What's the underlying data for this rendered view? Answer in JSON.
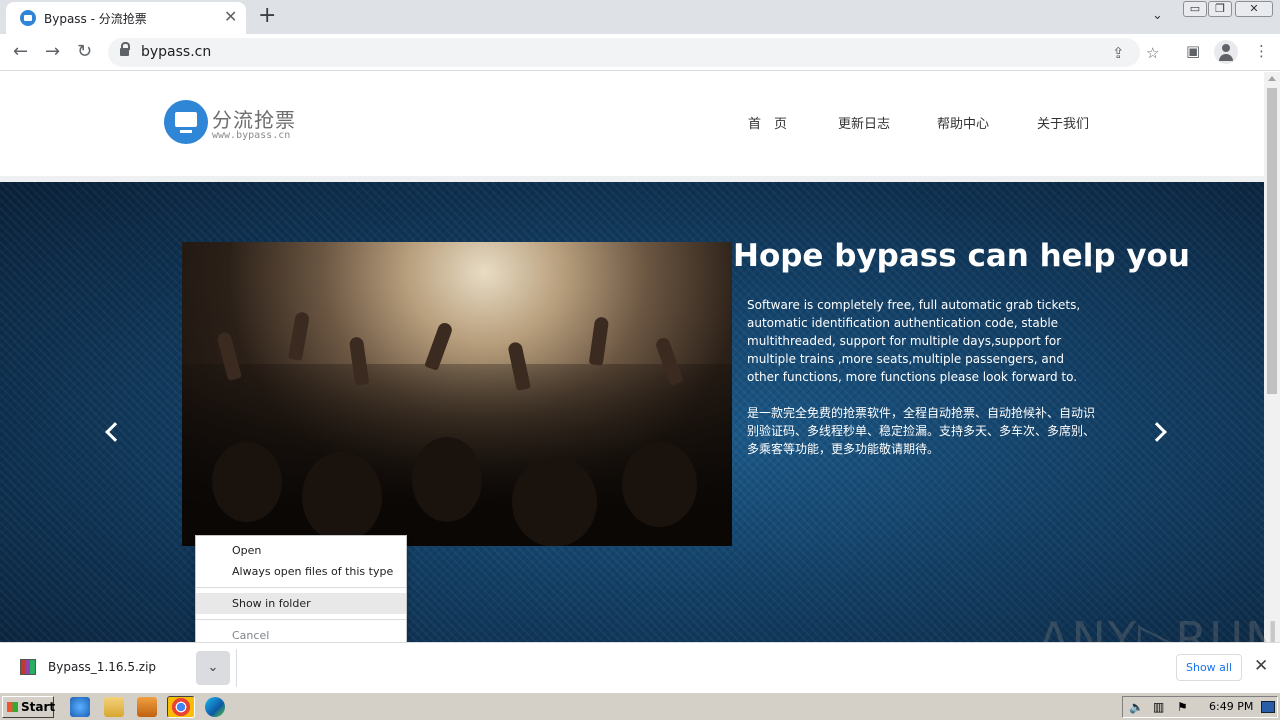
{
  "browser": {
    "tab_title": "Bypass - 分流抢票",
    "tab_close": "✕",
    "new_tab": "+",
    "tab_search": "⌄",
    "url": "bypass.cn",
    "window_controls": [
      "▭",
      "❐",
      "✕"
    ]
  },
  "site": {
    "logo_name": "分流抢票",
    "logo_domain": "www.bypass.cn",
    "nav": [
      "首　页",
      "更新日志",
      "帮助中心",
      "关于我们"
    ]
  },
  "hero": {
    "title": "Hope bypass can help you",
    "text_en": "Software is completely free, full automatic grab tickets, automatic identification authentication code, stable multithreaded, support for multiple days,support for multiple trains ,more seats,multiple passengers, and other functions, more functions please look forward to.",
    "text_zh": "是一款完全免费的抢票软件，全程自动抢票、自动抢候补、自动识别验证码、多线程秒单、稳定捡漏。支持多天、多车次、多席别、多乘客等功能，更多功能敬请期待。"
  },
  "context_menu": {
    "items": [
      "Open",
      "Always open files of this type",
      "Show in folder",
      "Cancel"
    ]
  },
  "download_shelf": {
    "file_name": "Bypass_1.16.5.zip",
    "show_all": "Show all",
    "close": "✕"
  },
  "watermark": "ANY▷RUN",
  "taskbar": {
    "start_label": "Start",
    "clock": "6:49 PM"
  },
  "colors": {
    "brand_blue": "#2f86d6",
    "hero_dark": "#0a2139",
    "link_blue": "#1a73e8"
  }
}
